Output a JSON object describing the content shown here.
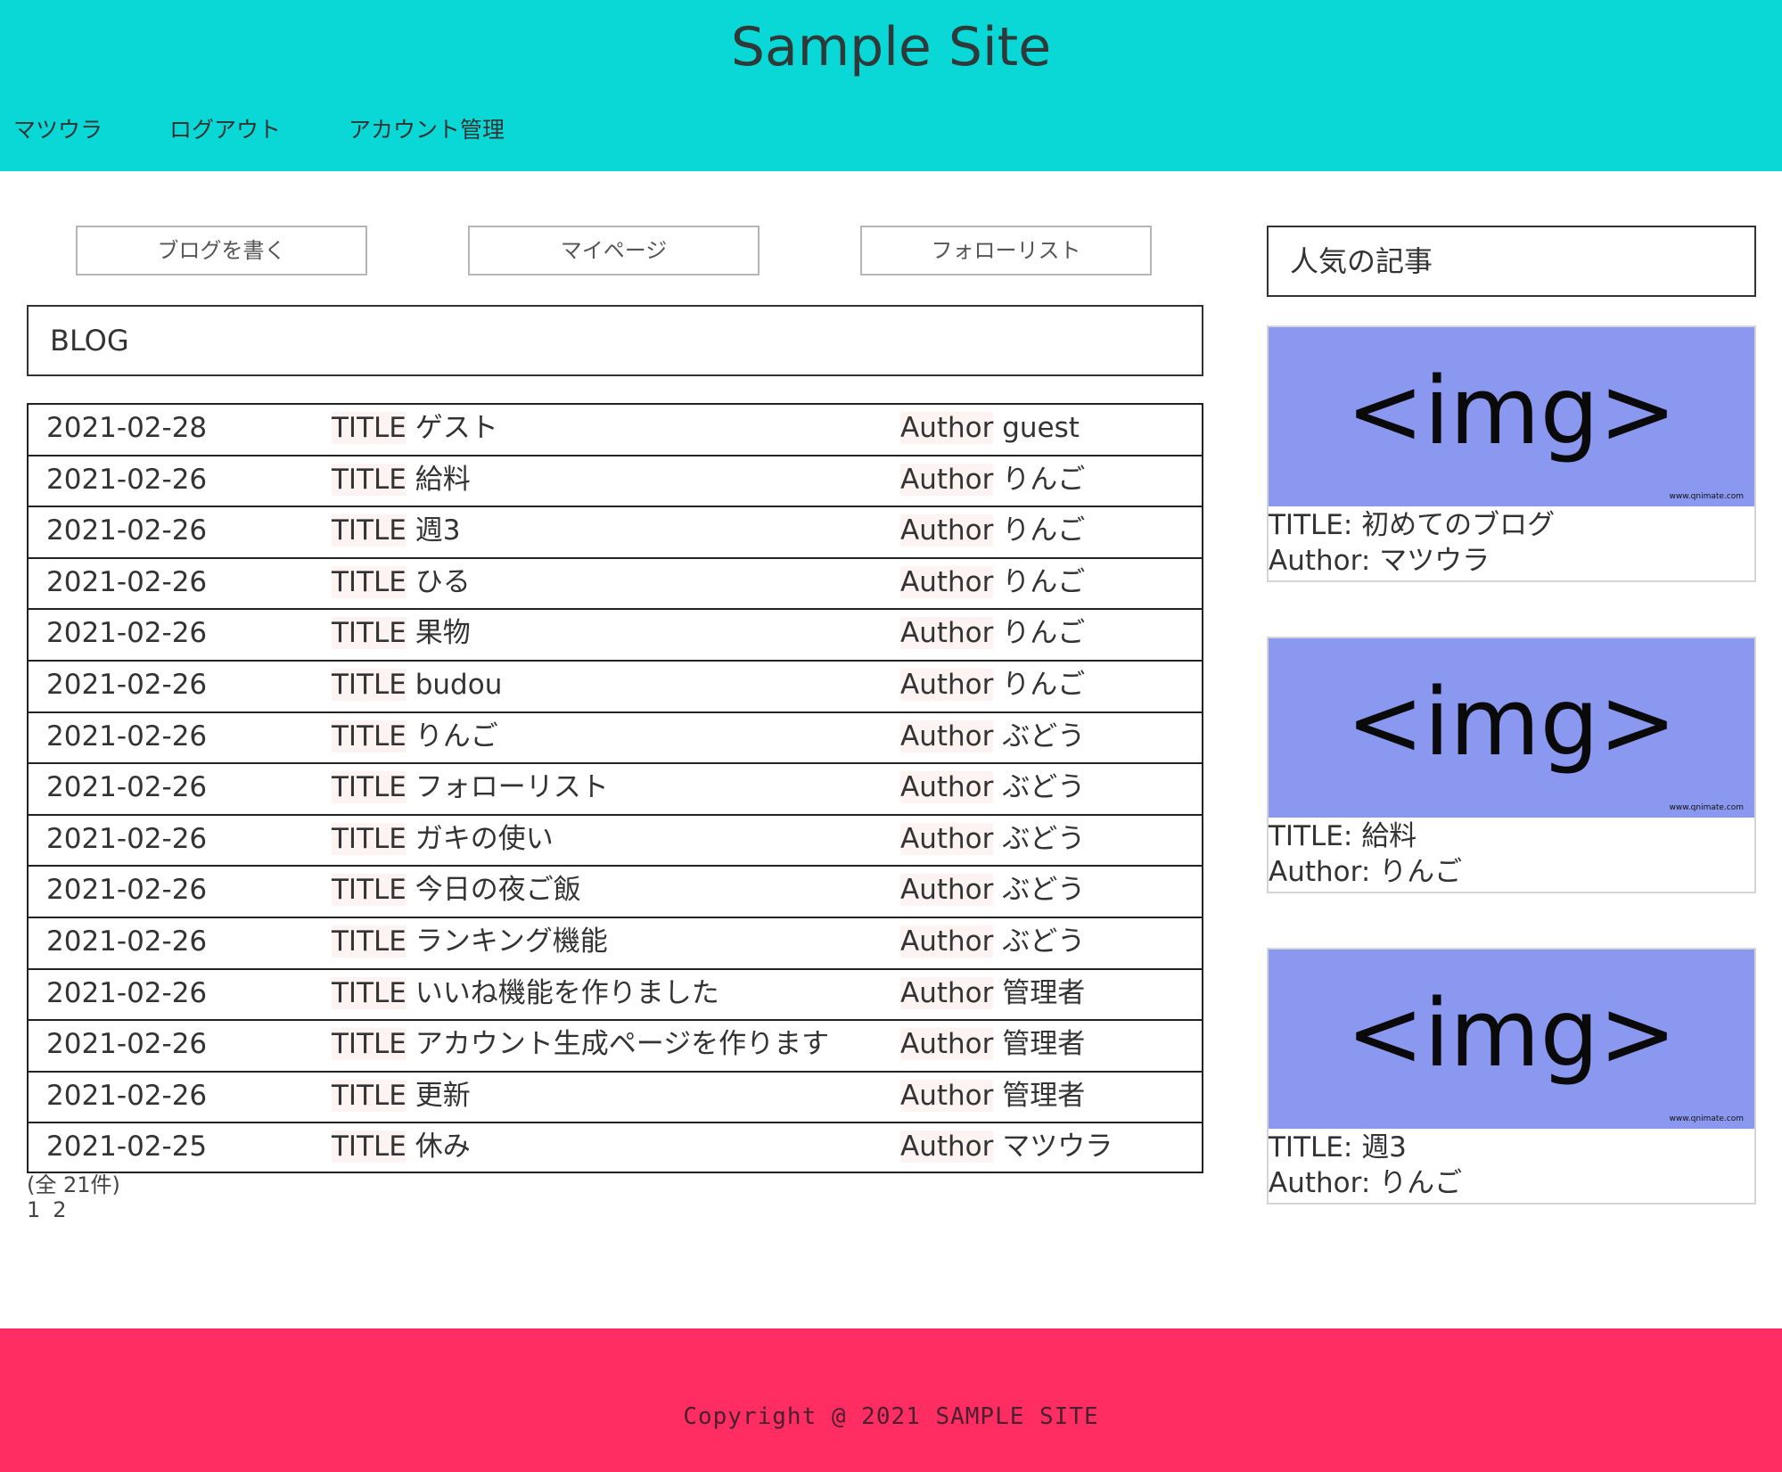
{
  "header": {
    "title": "Sample Site",
    "nav": [
      "マツウラ",
      "ログアウト",
      "アカウント管理"
    ]
  },
  "actions": [
    "ブログを書く",
    "マイページ",
    "フォローリスト"
  ],
  "blog": {
    "heading": "BLOG",
    "title_prefix": "TITLE",
    "author_prefix": "Author",
    "rows": [
      {
        "date": "2021-02-28",
        "title": "ゲスト",
        "author": "guest"
      },
      {
        "date": "2021-02-26",
        "title": "給料",
        "author": "りんご"
      },
      {
        "date": "2021-02-26",
        "title": "週3",
        "author": "りんご"
      },
      {
        "date": "2021-02-26",
        "title": "ひる",
        "author": "りんご"
      },
      {
        "date": "2021-02-26",
        "title": "果物",
        "author": "りんご"
      },
      {
        "date": "2021-02-26",
        "title": "budou",
        "author": "りんご"
      },
      {
        "date": "2021-02-26",
        "title": "りんご",
        "author": "ぶどう"
      },
      {
        "date": "2021-02-26",
        "title": "フォローリスト",
        "author": "ぶどう"
      },
      {
        "date": "2021-02-26",
        "title": "ガキの使い",
        "author": "ぶどう"
      },
      {
        "date": "2021-02-26",
        "title": "今日の夜ご飯",
        "author": "ぶどう"
      },
      {
        "date": "2021-02-26",
        "title": "ランキング機能",
        "author": "ぶどう"
      },
      {
        "date": "2021-02-26",
        "title": "いいね機能を作りました",
        "author": "管理者"
      },
      {
        "date": "2021-02-26",
        "title": "アカウント生成ページを作ります",
        "author": "管理者"
      },
      {
        "date": "2021-02-26",
        "title": "更新",
        "author": "管理者"
      },
      {
        "date": "2021-02-25",
        "title": "休み",
        "author": "マツウラ"
      }
    ],
    "count_text": "(全 21件)",
    "pages": [
      "1",
      "2"
    ]
  },
  "popular": {
    "heading": "人気の記事",
    "image_placeholder": "<img>",
    "image_credit": "www.qnimate.com",
    "title_label": "TITLE:",
    "author_label": "Author:",
    "items": [
      {
        "title": "初めてのブログ",
        "author": "マツウラ"
      },
      {
        "title": "給料",
        "author": "りんご"
      },
      {
        "title": "週3",
        "author": "りんご"
      }
    ]
  },
  "footer": {
    "copyright": "Copyright @ 2021 SAMPLE SITE"
  },
  "colors": {
    "header_bg": "#0ad8d7",
    "footer_bg": "#ff2d62",
    "image_bg": "#8b98ef"
  }
}
